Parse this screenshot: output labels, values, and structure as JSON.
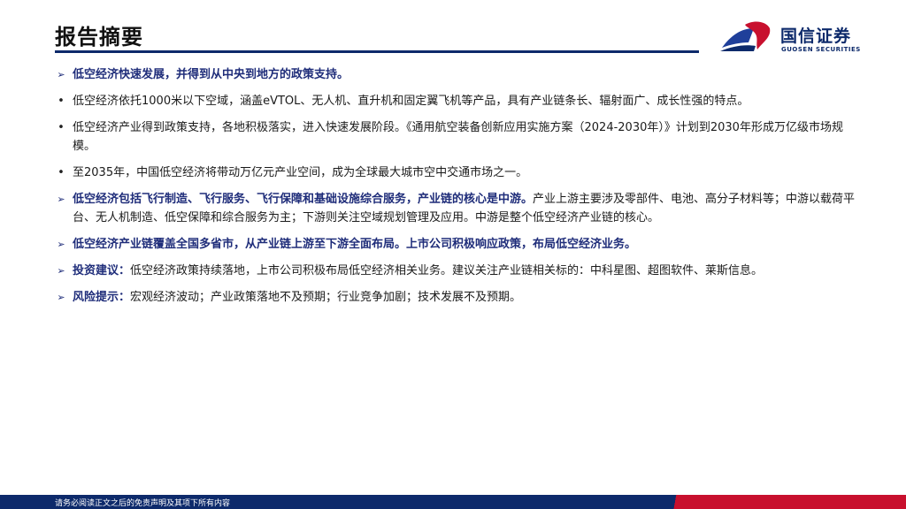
{
  "header": {
    "title": "报告摘要"
  },
  "brand": {
    "name_cn": "国信证券",
    "name_en": "GUOSEN SECURITIES",
    "logo": "guosen-logo-icon",
    "color_primary": "#0d2a6b",
    "color_accent": "#c8102e"
  },
  "icons": {
    "arrow": "arrow-bullet-icon",
    "dot": "dot-bullet-icon"
  },
  "items": [
    {
      "bold": "低空经济快速发展，并得到从中央到地方的政策支持。",
      "text": ""
    },
    {
      "text": "低空经济依托1000米以下空域，涵盖eVTOL、无人机、直升机和固定翼飞机等产品，具有产业链条长、辐射面广、成长性强的特点。"
    },
    {
      "text": "低空经济产业得到政策支持，各地积极落实，进入快速发展阶段。《通用航空装备创新应用实施方案（2024-2030年）》计划到2030年形成万亿级市场规模。"
    },
    {
      "text": "至2035年，中国低空经济将带动万亿元产业空间，成为全球最大城市空中交通市场之一。"
    },
    {
      "bold": "低空经济包括飞行制造、飞行服务、飞行保障和基础设施综合服务，产业链的核心是中游。",
      "text": "产业上游主要涉及零部件、电池、高分子材料等；中游以载荷平台、无人机制造、低空保障和综合服务为主；下游则关注空域规划管理及应用。中游是整个低空经济产业链的核心。"
    },
    {
      "bold": "低空经济产业链覆盖全国多省市，从产业链上游至下游全面布局。上市公司积极响应政策，布局低空经济业务。",
      "text": ""
    },
    {
      "bold": "投资建议：",
      "text": "低空经济政策持续落地，上市公司积极布局低空经济相关业务。建议关注产业链相关标的：中科星图、超图软件、莱斯信息。"
    },
    {
      "bold": "风险提示：",
      "text": "宏观经济波动；产业政策落地不及预期；行业竞争加剧；技术发展不及预期。"
    }
  ],
  "footer": {
    "disclaimer": "请务必阅读正文之后的免责声明及其项下所有内容"
  }
}
